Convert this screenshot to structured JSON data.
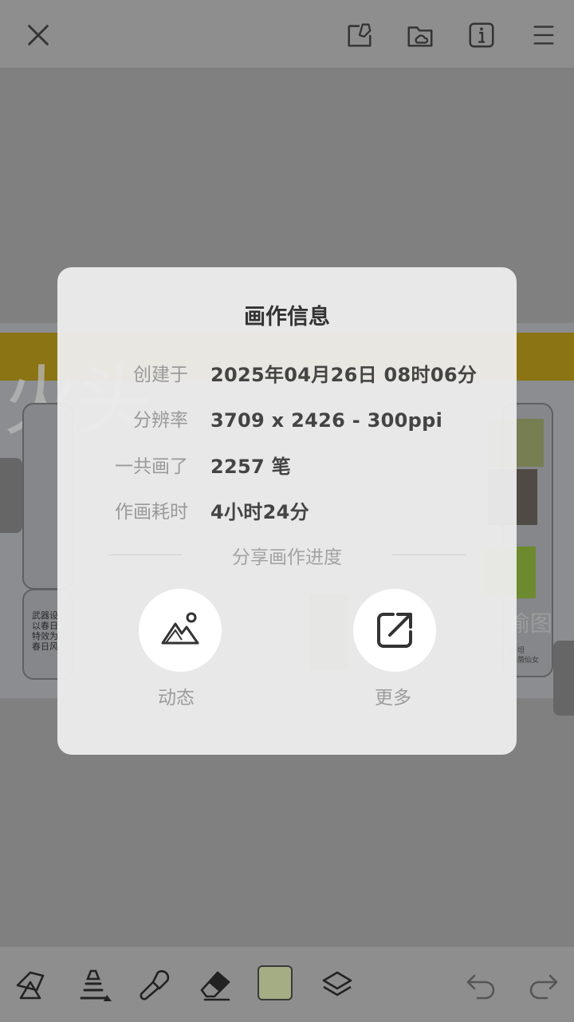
{
  "topbar": {
    "icons": [
      "close-icon",
      "edit-canvas-icon",
      "cloud-folder-icon",
      "info-icon",
      "menu-icon"
    ]
  },
  "background_art": {
    "big_text": "火头",
    "left_small_text": "武器设\n以春日\n特效为\n春日风",
    "right_text": "豹·偷图哟",
    "right_small_text": "舒坦\n林荫仙女"
  },
  "modal": {
    "title": "画作信息",
    "rows": [
      {
        "label": "创建于",
        "value": "2025年04月26日 08时06分"
      },
      {
        "label": "分辨率",
        "value": "3709 x 2426 - 300ppi"
      },
      {
        "label": "一共画了",
        "value": "2257 笔"
      },
      {
        "label": "作画耗时",
        "value": "4小时24分"
      }
    ],
    "share_title": "分享画作进度",
    "share_dynamic_label": "动态",
    "share_more_label": "更多"
  },
  "bottombar": {
    "icons": [
      "shapes-icon",
      "brush-icon",
      "smudge-icon",
      "eraser-icon",
      "color-swatch",
      "layers-icon",
      "undo-icon",
      "redo-icon"
    ],
    "current_color": "#a4ad84"
  },
  "colors": {
    "overlay": "#808080",
    "modal_bg": "#ececec",
    "accent_band": "#8a7413"
  }
}
